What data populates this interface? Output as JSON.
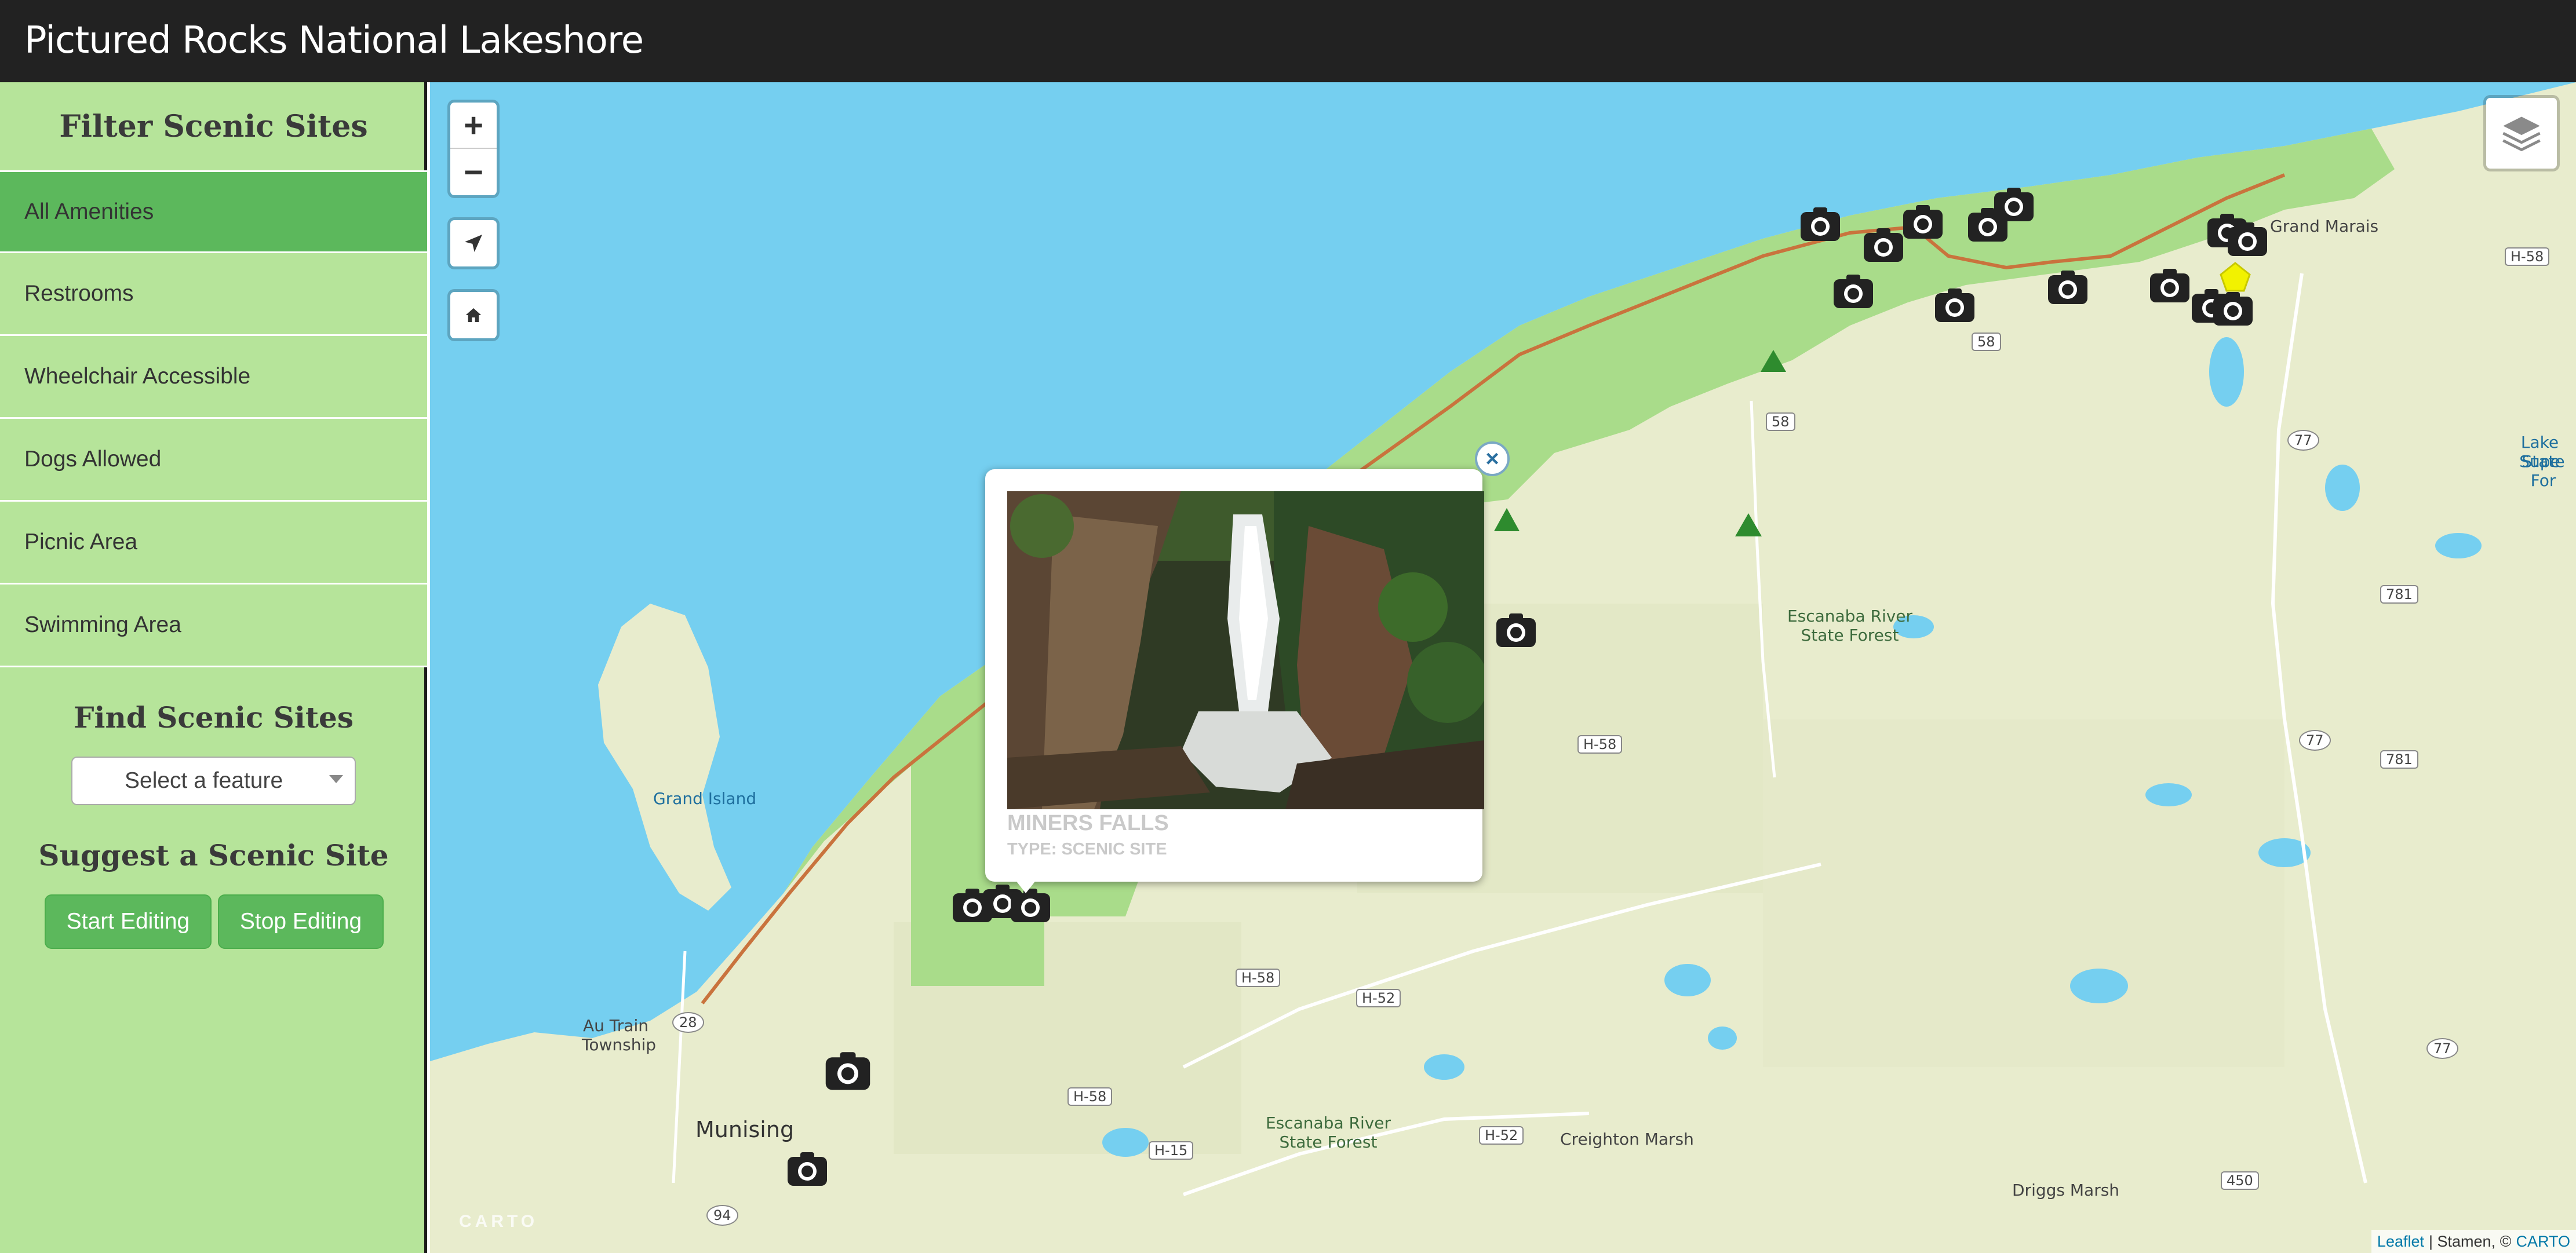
{
  "header": {
    "title": "Pictured Rocks National Lakeshore"
  },
  "sidebar": {
    "filter_heading": "Filter Scenic Sites",
    "filters": [
      {
        "label": "All Amenities",
        "active": true
      },
      {
        "label": "Restrooms",
        "active": false
      },
      {
        "label": "Wheelchair Accessible",
        "active": false
      },
      {
        "label": "Dogs Allowed",
        "active": false
      },
      {
        "label": "Picnic Area",
        "active": false
      },
      {
        "label": "Swimming Area",
        "active": false
      }
    ],
    "find_heading": "Find Scenic Sites",
    "select_value": "Select a feature",
    "suggest_heading": "Suggest a Scenic Site",
    "start_editing": "Start Editing",
    "stop_editing": "Stop Editing"
  },
  "map": {
    "zoom_in": "+",
    "zoom_out": "−",
    "popup": {
      "close": "×",
      "name": "MINERS FALLS",
      "type": "TYPE: SCENIC SITE"
    },
    "labels": {
      "grand_marais": "Grand Marais",
      "escanaba_river_1a": "Escanaba River",
      "escanaba_river_1b": "State Forest",
      "escanaba_river_2a": "Escanaba River",
      "escanaba_river_2b": "State Forest",
      "lake_superior_a": "Lake Supe",
      "lake_superior_b": "State For",
      "grand_island": "Grand Island",
      "au_train_a": "Au Train",
      "au_train_b": "Township",
      "munising": "Munising",
      "creighton_marsh": "Creighton Marsh",
      "driggs_marsh": "Driggs Marsh"
    },
    "shields": [
      "H-58",
      "58",
      "58",
      "H-58",
      "H-58",
      "H-58",
      "H-52",
      "H-52",
      "H-15",
      "H-58",
      "77",
      "77",
      "77",
      "781",
      "781",
      "28",
      "94",
      "450",
      "28"
    ],
    "attribution": {
      "leaflet": "Leaflet",
      "stamen": " | Stamen, © ",
      "carto": "CARTO"
    },
    "carto_logo": "CARTO"
  },
  "colors": {
    "header_bg": "#222222",
    "sidebar_bg": "#b6e49a",
    "accent_green": "#5cb85c",
    "water": "#75cff0",
    "land": "#e8eccd",
    "park": "#a9dc8a",
    "trail": "#c9733d"
  },
  "icons": {
    "scenic_marker": "camera-icon",
    "campground_marker": "triangle-icon",
    "visitor_marker": "pentagon-icon",
    "locate": "navigation-arrow-icon",
    "home": "home-icon",
    "layers": "layers-icon"
  }
}
